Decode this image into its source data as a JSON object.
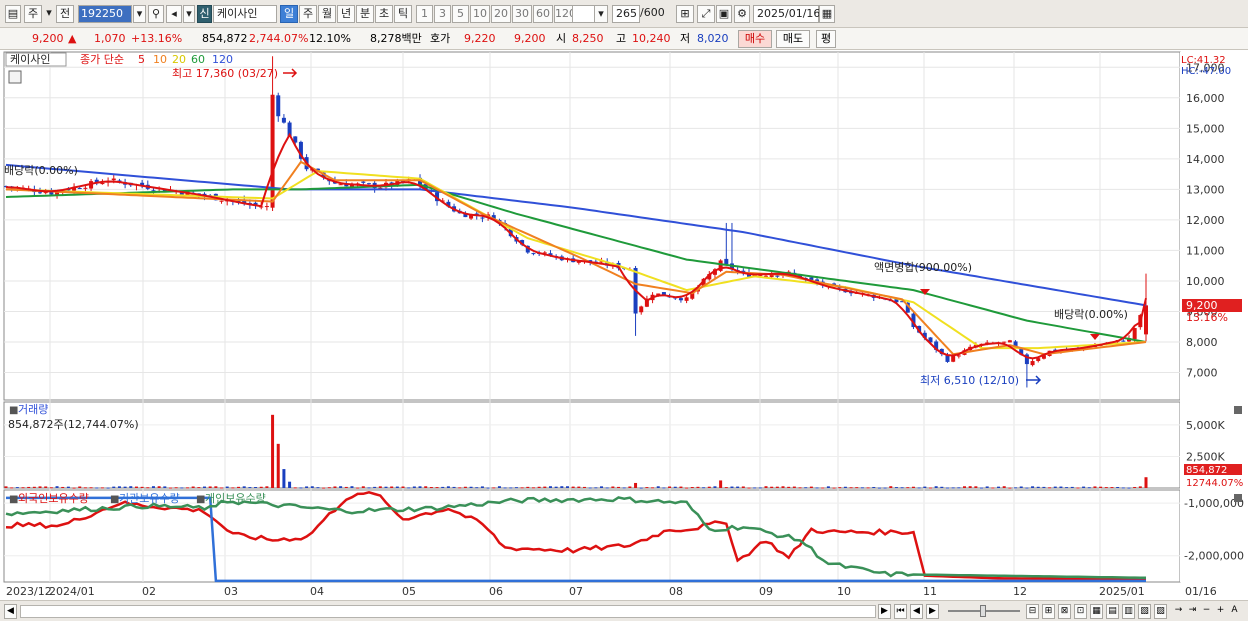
{
  "toolbar": {
    "type_select": "주",
    "prev_label": "전",
    "code": "192250",
    "name": "케이사인",
    "credit_badge": "신",
    "periods": [
      "일",
      "주",
      "월",
      "년",
      "분",
      "초",
      "틱"
    ],
    "active_period": "일",
    "intervals": [
      "1",
      "3",
      "5",
      "10",
      "20",
      "30",
      "60",
      "120"
    ],
    "count": "265",
    "count_max": "/600",
    "date": "2025/01/16"
  },
  "info": {
    "price": "9,200",
    "up_mark": "▲",
    "change": "1,070",
    "change_pct": "+13.16%",
    "volume": "854,872",
    "volume_pct": "2,744.07%",
    "turnover": "12.10%",
    "amount": "8,278백만",
    "quote_label": "호가",
    "ask": "9,220",
    "bid": "9,200",
    "open_label": "시",
    "open": "8,250",
    "high_label": "고",
    "high": "10,240",
    "low_label": "저",
    "low": "8,020",
    "buy_label": "매수",
    "sell_label": "매도",
    "eval_label": "평"
  },
  "colors": {
    "ma5": "#dd1111",
    "ma10": "#f08020",
    "ma20": "#f0e020",
    "ma60": "#1f9a3a",
    "ma120": "#3050d8",
    "up": "#dd1111",
    "down": "#1a3fbf",
    "foreign": "#dd1111",
    "institution": "#3070d8",
    "individual": "#3a9058",
    "price_tag_bg": "#e02020"
  },
  "chart_data": [
    {
      "type": "candlestick",
      "title": "케이사인",
      "legend": {
        "label": "종가 단순",
        "periods": [
          "5",
          "10",
          "20",
          "60",
          "120"
        ]
      },
      "corner": [
        "LC:41.32",
        "HC:-47.00"
      ],
      "y_ticks": [
        "17,000",
        "16,000",
        "15,000",
        "14,000",
        "13,000",
        "12,000",
        "11,000",
        "10,000",
        "9,000",
        "8,000",
        "7,000"
      ],
      "ylim": [
        6100,
        17500
      ],
      "current_price_tag": "9,200",
      "current_pct_tag": "13.16%",
      "annotations": {
        "high": "최고 17,360 (03/27)",
        "low": "최저 6,510 (12/10)",
        "div1": "배당락(0.00%)",
        "merge": "액면병합(900.00%)",
        "div2": "배당락(0.00%)"
      },
      "ohlc_anchors": [
        [
          0,
          13100
        ],
        [
          8,
          12900
        ],
        [
          18,
          13300
        ],
        [
          28,
          13000
        ],
        [
          35,
          12800
        ],
        [
          43,
          12500
        ],
        [
          47,
          12400
        ],
        [
          48,
          15500
        ],
        [
          50,
          14800
        ],
        [
          53,
          13700
        ],
        [
          58,
          13200
        ],
        [
          66,
          13100
        ],
        [
          72,
          13300
        ],
        [
          76,
          12700
        ],
        [
          80,
          12200
        ],
        [
          86,
          12100
        ],
        [
          92,
          11000
        ],
        [
          99,
          10700
        ],
        [
          104,
          10600
        ],
        [
          110,
          10400
        ],
        [
          111,
          9000
        ],
        [
          114,
          9600
        ],
        [
          120,
          9400
        ],
        [
          126,
          10600
        ],
        [
          130,
          10200
        ],
        [
          138,
          10250
        ],
        [
          145,
          9800
        ],
        [
          153,
          9500
        ],
        [
          158,
          9300
        ],
        [
          160,
          8500
        ],
        [
          166,
          7400
        ],
        [
          171,
          7900
        ],
        [
          177,
          8000
        ],
        [
          180,
          7300
        ],
        [
          184,
          7700
        ],
        [
          190,
          7800
        ],
        [
          198,
          8100
        ],
        [
          201,
          9200
        ]
      ],
      "ma_anchors": {
        "ma10": [
          [
            0,
            13000
          ],
          [
            47,
            12600
          ],
          [
            52,
            13900
          ],
          [
            58,
            13300
          ],
          [
            73,
            13300
          ],
          [
            84,
            12200
          ],
          [
            102,
            10700
          ],
          [
            111,
            9900
          ],
          [
            121,
            9600
          ],
          [
            127,
            10300
          ],
          [
            137,
            10200
          ],
          [
            150,
            9700
          ],
          [
            158,
            9400
          ],
          [
            167,
            7600
          ],
          [
            177,
            7900
          ],
          [
            183,
            7600
          ],
          [
            201,
            8000
          ]
        ],
        "ma20": [
          [
            0,
            13000
          ],
          [
            47,
            12700
          ],
          [
            55,
            13600
          ],
          [
            73,
            13350
          ],
          [
            92,
            11400
          ],
          [
            108,
            10500
          ],
          [
            120,
            9700
          ],
          [
            132,
            10150
          ],
          [
            148,
            9800
          ],
          [
            160,
            9300
          ],
          [
            172,
            7800
          ],
          [
            182,
            7800
          ],
          [
            201,
            8000
          ]
        ],
        "ma60": [
          [
            0,
            12750
          ],
          [
            40,
            13000
          ],
          [
            52,
            13000
          ],
          [
            73,
            13150
          ],
          [
            90,
            12200
          ],
          [
            120,
            10700
          ],
          [
            140,
            10200
          ],
          [
            160,
            9700
          ],
          [
            180,
            8700
          ],
          [
            201,
            8000
          ]
        ],
        "ma120": [
          [
            0,
            13800
          ],
          [
            50,
            13000
          ],
          [
            73,
            13000
          ],
          [
            100,
            12400
          ],
          [
            130,
            11600
          ],
          [
            160,
            10500
          ],
          [
            201,
            9200
          ]
        ]
      }
    },
    {
      "type": "bar",
      "title": "거래량",
      "subtitle": "854,872주(12,744.07%)",
      "y_ticks": [
        "5,000K",
        "2,500K"
      ],
      "ylim": [
        0,
        6500000
      ],
      "last_tag": "854,872",
      "last_pct_tag": "12744.07%",
      "spikes": [
        [
          47,
          5800000
        ],
        [
          48,
          3500000
        ],
        [
          49,
          1500000
        ],
        [
          50,
          500000
        ],
        [
          111,
          400000
        ],
        [
          126,
          600000
        ],
        [
          201,
          854872
        ]
      ],
      "base_volume": 80000
    },
    {
      "type": "line",
      "series": [
        {
          "name": "외국인보유수량",
          "anchors": [
            [
              0,
              -1420000
            ],
            [
              10,
              -1420000
            ],
            [
              20,
              -1000000
            ],
            [
              35,
              -1150000
            ],
            [
              40,
              -1600000
            ],
            [
              47,
              -1700000
            ],
            [
              53,
              -1650000
            ],
            [
              60,
              -900000
            ],
            [
              65,
              -800000
            ],
            [
              70,
              -1300000
            ],
            [
              78,
              -1100000
            ],
            [
              84,
              -1400000
            ],
            [
              88,
              -1850000
            ],
            [
              100,
              -1900000
            ],
            [
              110,
              -1800000
            ],
            [
              117,
              -1500000
            ],
            [
              120,
              -1500000
            ],
            [
              127,
              -1350000
            ],
            [
              129,
              -2100000
            ],
            [
              134,
              -1700000
            ],
            [
              138,
              -2050000
            ],
            [
              142,
              -1500000
            ],
            [
              145,
              -1550000
            ],
            [
              160,
              -1550000
            ],
            [
              162,
              -2380000
            ],
            [
              175,
              -2430000
            ],
            [
              201,
              -2450000
            ]
          ]
        },
        {
          "name": "기관보유수량",
          "anchors": [
            [
              0,
              -900000
            ],
            [
              36,
              -900000
            ],
            [
              37,
              -2480000
            ],
            [
              201,
              -2480000
            ]
          ]
        },
        {
          "name": "개인보유수량",
          "anchors": [
            [
              0,
              -1200000
            ],
            [
              25,
              -1050000
            ],
            [
              37,
              -1100000
            ],
            [
              38,
              -950000
            ],
            [
              60,
              -1150000
            ],
            [
              75,
              -1100000
            ],
            [
              90,
              -950000
            ],
            [
              108,
              -920000
            ],
            [
              120,
              -1000000
            ],
            [
              124,
              -1500000
            ],
            [
              130,
              -1450000
            ],
            [
              140,
              -1700000
            ],
            [
              145,
              -2150000
            ],
            [
              155,
              -2350000
            ],
            [
              201,
              -2420000
            ]
          ]
        }
      ],
      "y_ticks": [
        "-1,000,000",
        "-2,000,000"
      ],
      "ylim": [
        -2500000,
        -750000
      ]
    }
  ],
  "x_axis_labels": [
    "2023/12",
    "2024/01",
    "02",
    "03",
    "04",
    "05",
    "06",
    "07",
    "08",
    "09",
    "10",
    "11",
    "12",
    "2025/01",
    "01/16"
  ]
}
